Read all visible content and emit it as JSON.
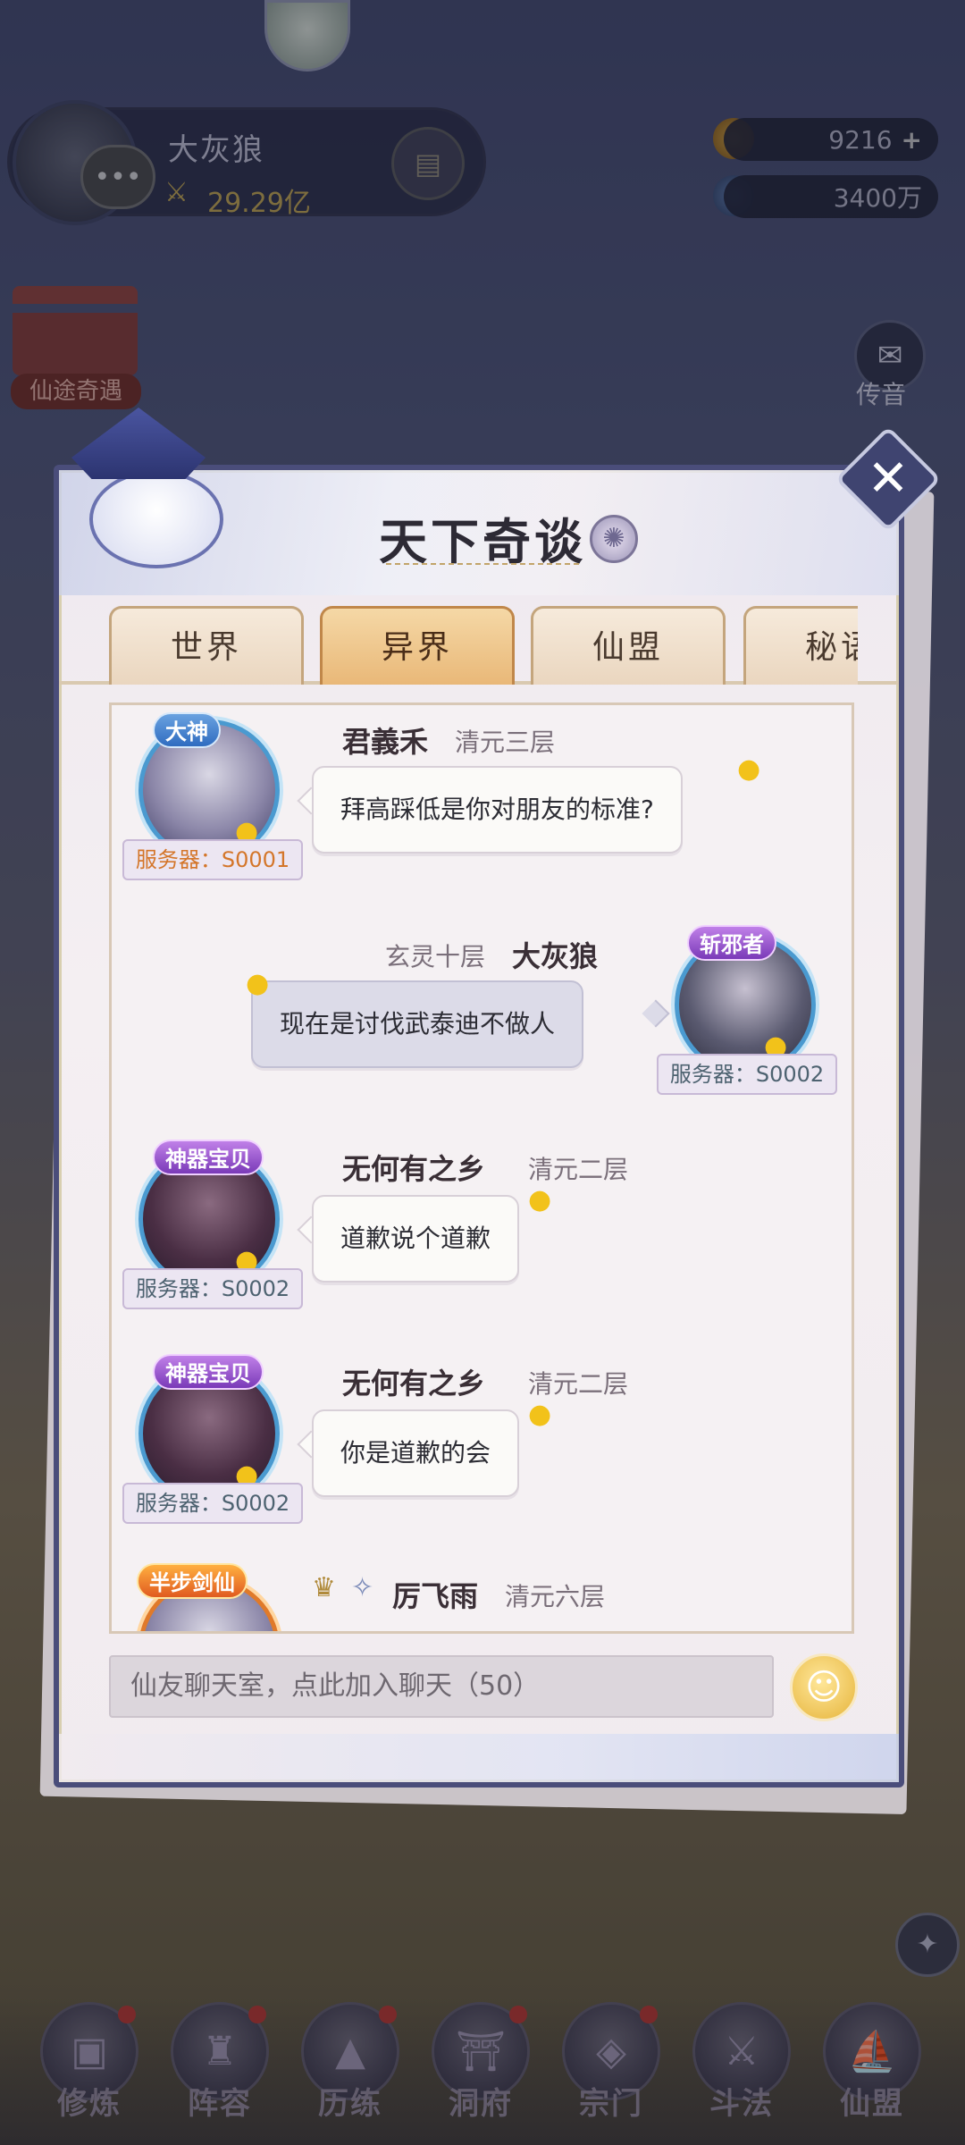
{
  "hud": {
    "player_name": "大灰狼",
    "player_power": "29.29亿",
    "currency_gold": "9216",
    "currency_jade": "3400万",
    "plus_symbol": "+",
    "shrine_label": "仙途奇遇",
    "mail_label": "传音"
  },
  "dialog": {
    "title": "天下奇谈",
    "tabs": [
      {
        "label": "世界"
      },
      {
        "label": "异界"
      },
      {
        "label": "仙盟"
      },
      {
        "label": "秘语"
      }
    ],
    "active_tab": "异界",
    "close_symbol": "✕"
  },
  "messages": [
    {
      "name": "君義禾",
      "rank": "清元三层",
      "text": "拜高踩低是你对朋友的标准?",
      "server": "服务器：S0001",
      "badge": "大神",
      "side": "left"
    },
    {
      "name": "大灰狼",
      "rank": "玄灵十层",
      "text": "现在是讨伐武泰迪不做人",
      "server": "服务器：S0002",
      "badge": "斩邪者",
      "side": "right"
    },
    {
      "name": "无何有之乡",
      "rank": "清元二层",
      "text": "道歉说个道歉",
      "server": "服务器：S0002",
      "badge": "神器宝贝",
      "side": "left"
    },
    {
      "name": "无何有之乡",
      "rank": "清元二层",
      "text": "你是道歉的会",
      "server": "服务器：S0002",
      "badge": "神器宝贝",
      "side": "left"
    },
    {
      "name": "厉飞雨",
      "rank": "清元六层",
      "badge": "半步剑仙",
      "side": "left"
    }
  ],
  "input": {
    "placeholder": "仙友聊天室，点此加入聊天（50）"
  },
  "bottom_nav": [
    {
      "label": "修炼"
    },
    {
      "label": "阵容"
    },
    {
      "label": "历练"
    },
    {
      "label": "洞府"
    },
    {
      "label": "宗门"
    },
    {
      "label": "斗法"
    },
    {
      "label": "仙盟"
    }
  ],
  "colors": {
    "accent_tab": "#e9b878",
    "dialog_border": "#4a4d7a",
    "server_orange": "#d4762a"
  }
}
